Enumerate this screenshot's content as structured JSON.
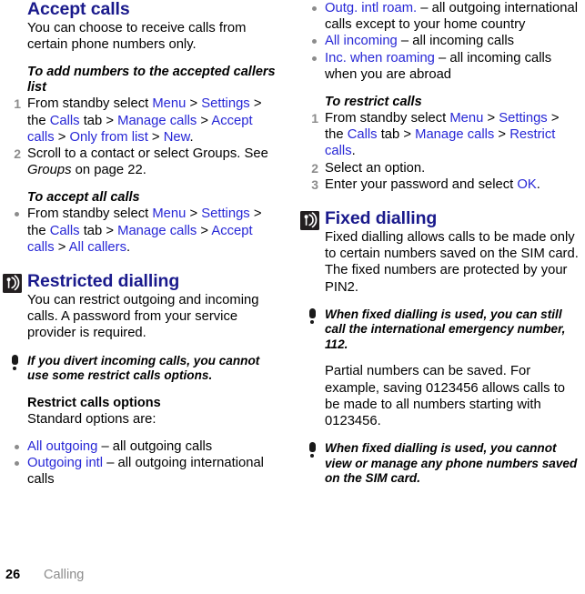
{
  "page": {
    "number": "26",
    "chapter": "Calling"
  },
  "left_column": {
    "section_accept": {
      "heading": "Accept calls",
      "intro": "You can choose to receive calls from certain phone numbers only.",
      "sub1": {
        "heading": "To add numbers to the accepted callers list",
        "steps": [
          {
            "num": "1",
            "parts": [
              {
                "t": "From standby select ",
                "s": "plain"
              },
              {
                "t": "Menu",
                "s": "link"
              },
              {
                "t": " > ",
                "s": "plain"
              },
              {
                "t": "Settings",
                "s": "link"
              },
              {
                "t": " > the ",
                "s": "plain"
              },
              {
                "t": "Calls",
                "s": "link"
              },
              {
                "t": " tab > ",
                "s": "plain"
              },
              {
                "t": "Manage calls",
                "s": "link"
              },
              {
                "t": " > ",
                "s": "plain"
              },
              {
                "t": "Accept calls",
                "s": "link"
              },
              {
                "t": " > ",
                "s": "plain"
              },
              {
                "t": "Only from list",
                "s": "link"
              },
              {
                "t": " > ",
                "s": "plain"
              },
              {
                "t": "New",
                "s": "link"
              },
              {
                "t": ".",
                "s": "plain"
              }
            ]
          },
          {
            "num": "2",
            "parts": [
              {
                "t": "Scroll to a contact or select Groups. See ",
                "s": "plain"
              },
              {
                "t": "Groups",
                "s": "italic"
              },
              {
                "t": " on page 22.",
                "s": "plain"
              }
            ]
          }
        ]
      },
      "sub2": {
        "heading": "To accept all calls",
        "bullets": [
          {
            "parts": [
              {
                "t": "From standby select ",
                "s": "plain"
              },
              {
                "t": "Menu",
                "s": "link"
              },
              {
                "t": " > ",
                "s": "plain"
              },
              {
                "t": "Settings",
                "s": "link"
              },
              {
                "t": " > the ",
                "s": "plain"
              },
              {
                "t": "Calls",
                "s": "link"
              },
              {
                "t": " tab > ",
                "s": "plain"
              },
              {
                "t": "Manage calls",
                "s": "link"
              },
              {
                "t": " > ",
                "s": "plain"
              },
              {
                "t": "Accept calls",
                "s": "link"
              },
              {
                "t": " > ",
                "s": "plain"
              },
              {
                "t": "All callers",
                "s": "link"
              },
              {
                "t": ".",
                "s": "plain"
              }
            ]
          }
        ]
      }
    },
    "section_restricted": {
      "icon": "antenna-signal-icon",
      "heading": "Restricted dialling",
      "intro": "You can restrict outgoing and incoming calls. A password from your service provider is required.",
      "note": "If you divert incoming calls, you cannot use some restrict calls options.",
      "options_heading": "Restrict calls options",
      "options_intro": "Standard options are:",
      "options": [
        {
          "parts": [
            {
              "t": "All outgoing",
              "s": "link"
            },
            {
              "t": " – all outgoing calls",
              "s": "plain"
            }
          ]
        },
        {
          "parts": [
            {
              "t": "Outgoing intl",
              "s": "link"
            },
            {
              "t": " – all outgoing international calls",
              "s": "plain"
            }
          ]
        }
      ]
    }
  },
  "right_column": {
    "options_continued": [
      {
        "parts": [
          {
            "t": "Outg. intl roam.",
            "s": "link"
          },
          {
            "t": " – all outgoing international calls except to your home country",
            "s": "plain"
          }
        ]
      },
      {
        "parts": [
          {
            "t": "All incoming",
            "s": "link"
          },
          {
            "t": " – all incoming calls",
            "s": "plain"
          }
        ]
      },
      {
        "parts": [
          {
            "t": "Inc. when roaming",
            "s": "link"
          },
          {
            "t": " – all incoming calls when you are abroad",
            "s": "plain"
          }
        ]
      }
    ],
    "sub_restrict": {
      "heading": "To restrict calls",
      "steps": [
        {
          "num": "1",
          "parts": [
            {
              "t": "From standby select ",
              "s": "plain"
            },
            {
              "t": "Menu",
              "s": "link"
            },
            {
              "t": " > ",
              "s": "plain"
            },
            {
              "t": "Settings",
              "s": "link"
            },
            {
              "t": " > the ",
              "s": "plain"
            },
            {
              "t": "Calls",
              "s": "link"
            },
            {
              "t": " tab > ",
              "s": "plain"
            },
            {
              "t": "Manage calls",
              "s": "link"
            },
            {
              "t": " > ",
              "s": "plain"
            },
            {
              "t": "Restrict calls",
              "s": "link"
            },
            {
              "t": ".",
              "s": "plain"
            }
          ]
        },
        {
          "num": "2",
          "parts": [
            {
              "t": "Select an option.",
              "s": "plain"
            }
          ]
        },
        {
          "num": "3",
          "parts": [
            {
              "t": "Enter your password and select ",
              "s": "plain"
            },
            {
              "t": "OK",
              "s": "link"
            },
            {
              "t": ".",
              "s": "plain"
            }
          ]
        }
      ]
    },
    "section_fixed": {
      "icon": "antenna-signal-icon",
      "heading": "Fixed dialling",
      "intro": "Fixed dialling allows calls to be made only to certain numbers saved on the SIM card. The fixed numbers are protected by your PIN2.",
      "note1": "When fixed dialling is used, you can still call the international emergency number, 112.",
      "body": "Partial numbers can be saved. For example, saving 0123456 allows calls to be made to all numbers starting with 0123456.",
      "note2": "When fixed dialling is used, you cannot view or manage any phone numbers saved on the SIM card."
    }
  },
  "colors": {
    "heading_navy": "#1a1a8c",
    "link_blue": "#2727d6",
    "marker_gray": "#8c8c8c",
    "icon_dark": "#231f20",
    "text_black": "#000000"
  }
}
